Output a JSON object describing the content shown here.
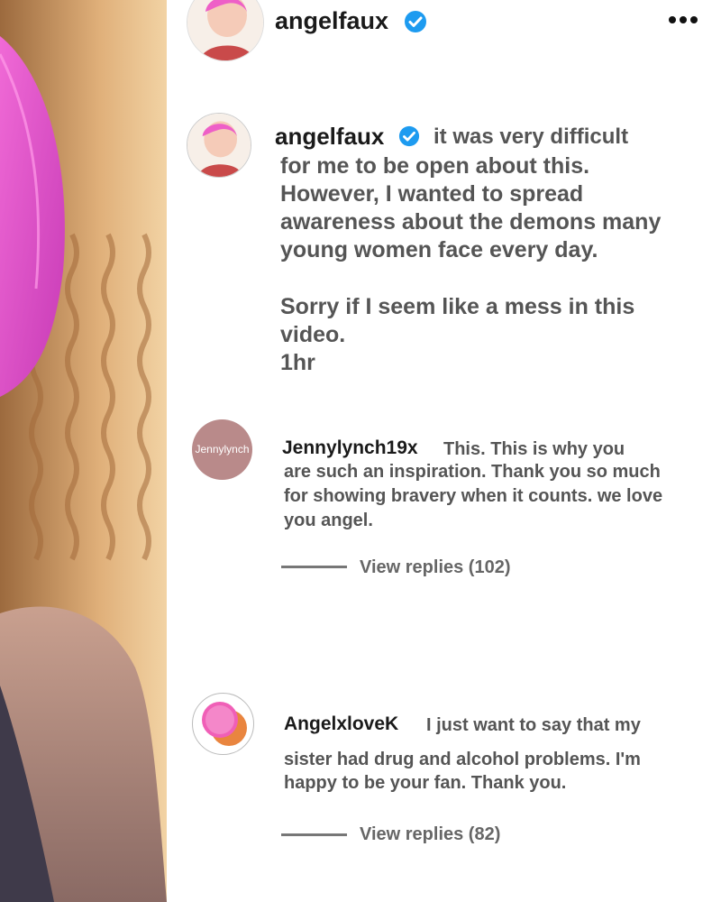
{
  "header": {
    "username": "angelfaux"
  },
  "caption": {
    "username": "angelfaux",
    "lines": [
      "it was very difficult",
      "for me to be open about this.",
      "However, I wanted to spread",
      "awareness about the demons many",
      "young women face every day.",
      "Sorry if I seem like a mess in this",
      "video."
    ],
    "time": "1hr"
  },
  "comments": [
    {
      "username": "Jennylynch19x",
      "avatar_text": "Jennylynch",
      "lines": [
        "This. This is why you",
        "are such an inspiration. Thank you so much",
        "for showing bravery when it counts.  we love",
        "you angel."
      ],
      "replies_label": "View replies (102)"
    },
    {
      "username": "AngelxloveK",
      "lines": [
        "I just want to say that my",
        "sister had drug and alcohol problems. I'm",
        "happy to be your fan. Thank you."
      ],
      "replies_label": "View replies (82)"
    }
  ],
  "colors": {
    "verified": "#1d9bf0",
    "avatar_bg": "#b98a8a",
    "text": "#555555"
  },
  "icons": [
    "verified-badge-icon",
    "more-options-icon"
  ]
}
